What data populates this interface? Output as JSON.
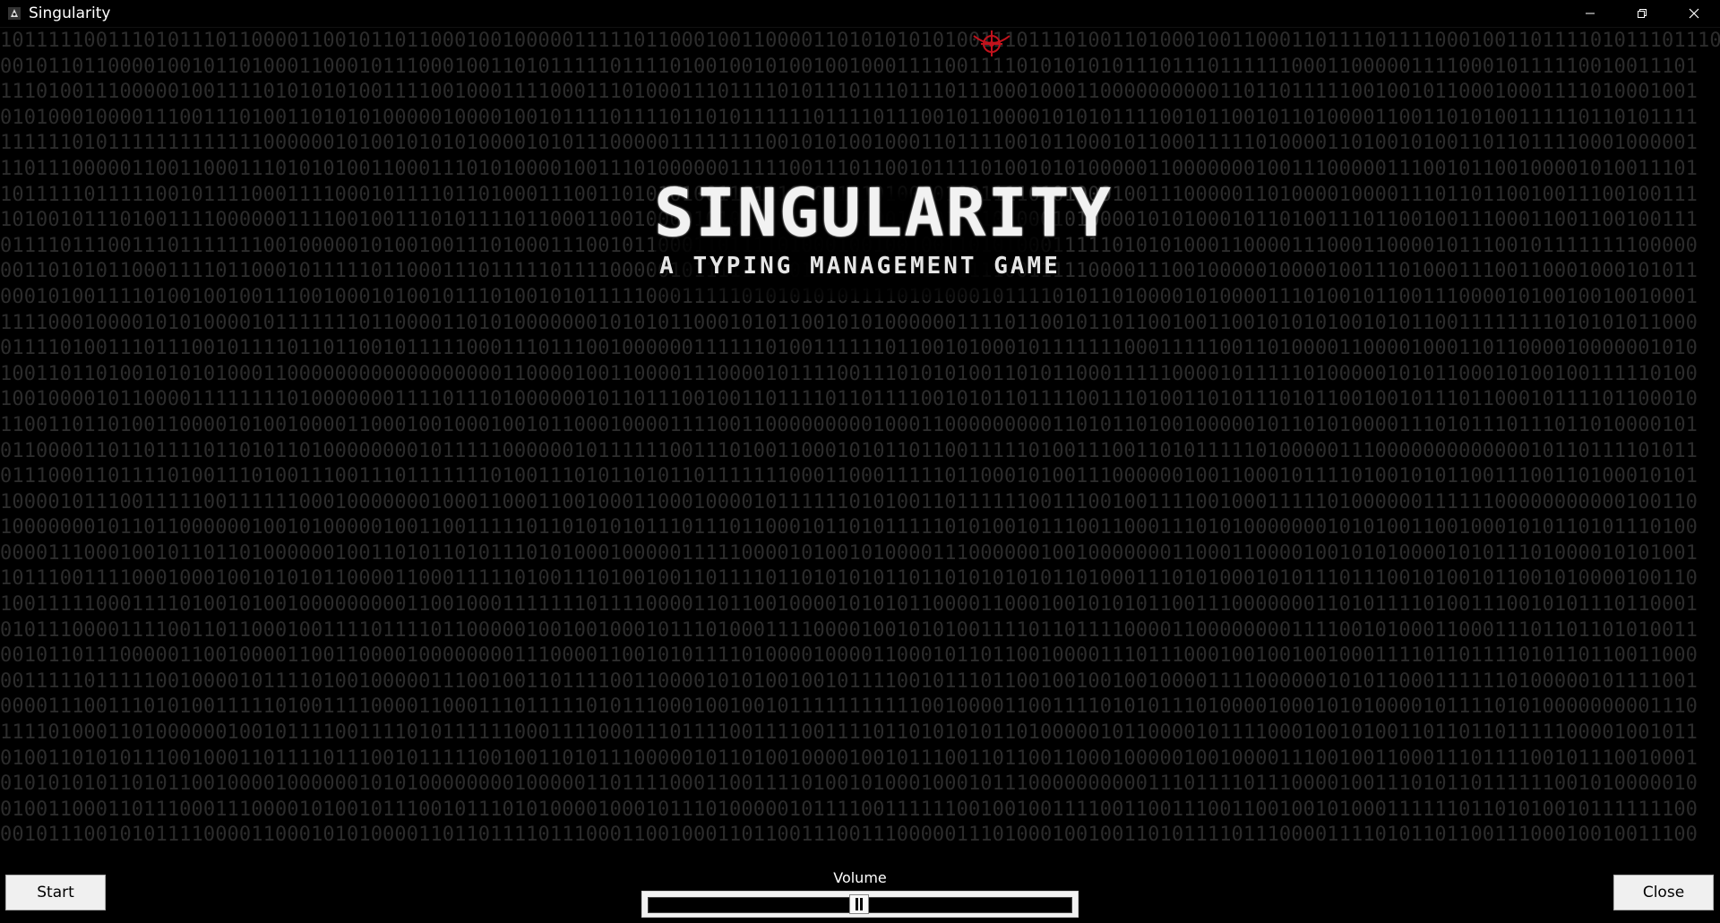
{
  "window": {
    "title": "Singularity",
    "controls": {
      "minimize_icon": "minimize-icon",
      "maximize_icon": "restore-icon",
      "close_icon": "close-icon"
    }
  },
  "game": {
    "logo_title": "SINGULARITY",
    "logo_subtitle": "A TYPING MANAGEMENT GAME",
    "background": "binary-digit-matrix",
    "crosshair_icon": "crosshair-icon",
    "crosshair_color": "#c1121c"
  },
  "matrix_rows": [
    "1011111001110101110110000110010110110001001000001111101100010011000011010101010100111011101001101000100110001101111011110001001101111010111011101",
    "0010110110000100101101000110001011100010011010111110111101001001010010010001111001111010101010111011101111110001100000111100010111110010011101",
    "1110100111000001001111010101010011110010001111000111010001110111101011101110111011100010001100000000001101101111100100101100010001111010001001",
    "0101000100001110011101001101010100000100001001011110111101101011111101111011100101100001010101111001011001011010000110011010100111110110101111",
    "1111110101111111111111000000101001010101000010101110000011111111001010100100011011110010110001011000111110100001101001010011011011110001000001",
    "1101110000011001100011101010100110001110101000010011101000000111110011101100101111010010101000001100000001001110000011100101100100001010011101",
    "1011111011111001011110001111000101111011010001110011010101001101110100111010000100111101010001001110000011010000100001110110110010011100100111",
    "1010010111010011110000001111001001110101111011000110010000101001101011010001010100101000101000010101000101101001110110010011100011001100100111",
    "0111101110011101111111001000001010010011101000111001011000110111101000100100100110101000111110101010001100001110001100001011100101111111100000",
    "0011010101100011110110001011111011000111011111011110000010111111100111110001110111110011111000011100100000100001001110100011100110001000101011",
    "0001010011110100100100111001000101001011101001010111110001111101010101011110101000101111010110100001010000111010010110011100001010010010010001",
    "1111000100001010100001011111110110000110101000000010101011000101011001010100000011110110010110110010011001010101001010110011111111010101011000",
    "0111101001110111001011110110110010111110001110111001000000111111010011111101100101000101111111000111110011010000110000100011011000010000001010",
    "1001101101001010101000110000000000000000001100001001100001110000101111001110101010011010110001111100001011111010000010101100010100100111110100",
    "1001000010110000111111110100000001111011101000000101101110010011011110110111100101011011110011101001101011101011001001011101100010111101100010",
    "1100110110100110000101001000011000100100010010110001000011110011000000000100011000000000110101101001000001011010100001110101110111011010000101",
    "0110000110110111101101011010000000010111110000001011111100111010011000101011011001111101001110011010111110100000111000000000000010110111101011",
    "0111000110111101001110100111001110111111101001110101101011011111110001100011111011000101001110000001001100010111101001010110011100110100010101",
    "1000010111001111100111111000100000001000110001100100011000100001011111101010011011111100111001001111001000111110100000011111100000000000100110",
    "1000000010110110000001001010000010011001111101101010101110111011000101101011111010100101110011000111010100000001010100110010001010110101110100",
    "0000111000100101101101000000100110101101011101010001000001111100001010010100001110000001001000000011000110000100101010000101011101000010101001",
    "1011100111100010001001010101100001100011111010011101001001101111011010101011011010101010110100011101010001010111011100101001011001010000100110",
    "1001111100011110100101001000000000110010001111111011110000110110010000101010110000110001001010101100111000000011010111101001110010101110110001",
    "0101110000111100110110001001111011110110000010010010001011101000111100001001010100111101101111000011000000001111001010001100011101101101010011",
    "0010110111000001100100001100110000100000000111000011001010111101000010000110001011011001000011101110001001001001000111101101111010110110011000",
    "0011111011111001000010111101001000001110010011011110011000010101001001011110010111011001001001001000011110000001010110001111110100000101111001",
    "0000111001110101001111101001111000011000111011111010111000100100101111111111100100001100111101010111010000100010101000010111101010000000001110",
    "1111010001101000000100101111001111010111111000111100011101111001111001111011010101011010000010110000101111000100101001101101101111100001001011",
    "0100110101011100100011011110111001011111001001101011100000101101001000010010111001101100110001000001001000011100100110001110111100101110010001",
    "0101010101101011001000010000001010100000000100000110111100011001111010010100010001011100000000001110111101110000100111010110111111001010000010",
    "0100110001101110001110000101001011100101110101000010001011101000001011110011111100100100111100110011100110010010100011111101101010010111111100",
    "0010111001010111100001100010101000011011011110111000110010001101100111001110000011101000100100110101111011100001111010110110011100010010011100"
  ]
}
